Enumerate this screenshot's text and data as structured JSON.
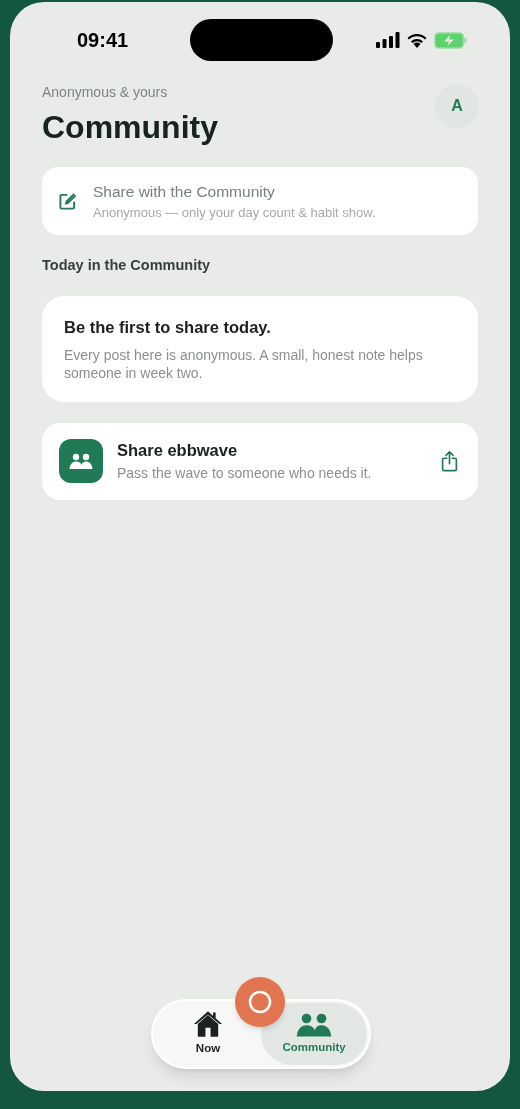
{
  "status_bar": {
    "time": "09:41"
  },
  "header": {
    "eyebrow": "Anonymous & yours",
    "title": "Community",
    "avatar": "A"
  },
  "composer": {
    "title": "Share with the Community",
    "subtitle": "Anonymous — only your day count & habit show."
  },
  "section_title": "Today in the Community",
  "empty_card": {
    "title": "Be the first to share today.",
    "body": "Every post here is anonymous. A small, honest note helps someone in week two."
  },
  "share_card": {
    "title": "Share ebbwave",
    "subtitle": "Pass the wave to someone who needs it."
  },
  "tabs": [
    {
      "kind": "home",
      "label": "Now",
      "selected": false
    },
    {
      "kind": "people",
      "label": "Community",
      "selected": true
    }
  ]
}
